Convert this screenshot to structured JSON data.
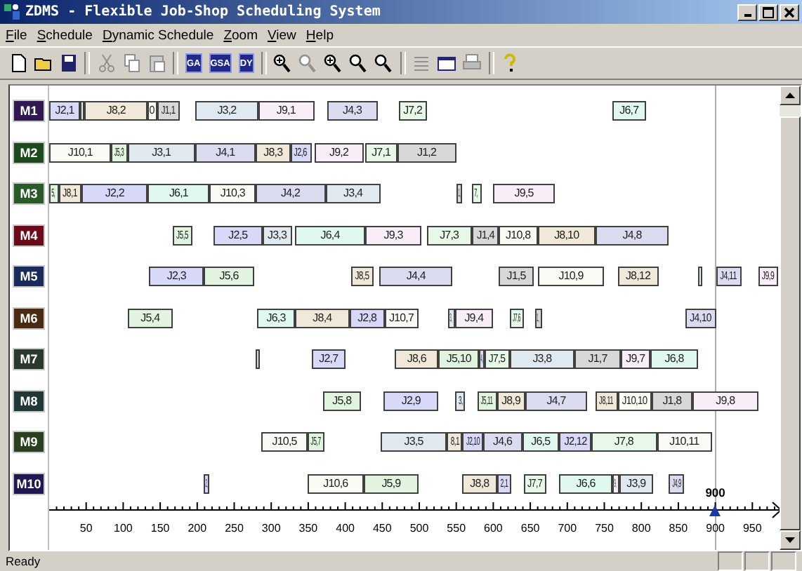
{
  "window": {
    "title": "ZDMS - Flexible Job-Shop Scheduling System"
  },
  "menu": [
    {
      "label": "File"
    },
    {
      "label": "Schedule"
    },
    {
      "label": "Dynamic Schedule"
    },
    {
      "label": "Zoom"
    },
    {
      "label": "View"
    },
    {
      "label": "Help"
    }
  ],
  "toolbar": [
    {
      "kind": "new"
    },
    {
      "kind": "open"
    },
    {
      "kind": "save"
    },
    {
      "kind": "sep"
    },
    {
      "kind": "cut",
      "disabled": true
    },
    {
      "kind": "copy",
      "disabled": true
    },
    {
      "kind": "paste",
      "disabled": true
    },
    {
      "kind": "sep"
    },
    {
      "kind": "text",
      "label": "GA"
    },
    {
      "kind": "text",
      "label": "GSA"
    },
    {
      "kind": "text",
      "label": "DY"
    },
    {
      "kind": "sep"
    },
    {
      "kind": "zoomin"
    },
    {
      "kind": "zoom",
      "disabled": true
    },
    {
      "kind": "zoomin"
    },
    {
      "kind": "zoom"
    },
    {
      "kind": "zoom"
    },
    {
      "kind": "sep"
    },
    {
      "kind": "list",
      "disabled": true
    },
    {
      "kind": "window"
    },
    {
      "kind": "print",
      "disabled": true
    },
    {
      "kind": "sep"
    },
    {
      "kind": "help"
    }
  ],
  "machines": [
    {
      "name": "M1",
      "color": "#301850",
      "ops": [
        {
          "label": "J2,1",
          "color": "#d8d8f8"
        },
        {
          "color": "#e0f4e0"
        },
        {
          "label": "J8,2",
          "color": "#f0e8d8"
        },
        {
          "label": "0",
          "color": "#f8faf4"
        },
        {
          "label": "J1,1",
          "color": "#d8d8d8"
        },
        {
          "label": "J3,2",
          "color": "#e0e8f0"
        },
        {
          "label": "J9,1",
          "color": "#f8eef8"
        },
        {
          "label": "J4,3",
          "color": "#dcdcf0"
        },
        {
          "label": "J7,2",
          "color": "#e8f8e8"
        },
        {
          "label": "J6,7",
          "color": "#e0f8f0"
        }
      ]
    },
    {
      "name": "M2",
      "color": "#1c4a1c",
      "ops": [
        {
          "label": "J10,1",
          "color": "#f8faf4"
        },
        {
          "label": "J5,3",
          "color": "#e0f4e0"
        },
        {
          "label": "J3,1",
          "color": "#e0e8f0"
        },
        {
          "label": "J4,1",
          "color": "#dcdcf0"
        },
        {
          "label": "J8,3",
          "color": "#f0e8d8"
        },
        {
          "label": "J2,6",
          "color": "#d8d8f8"
        },
        {
          "label": "J9,2",
          "color": "#f8eef8"
        },
        {
          "label": "J7,1",
          "color": "#e8f8e8"
        },
        {
          "label": "J1,2",
          "color": "#d8d8d8"
        }
      ]
    },
    {
      "name": "M3",
      "color": "#2a5a2a",
      "ops": [
        {
          "label": "5,",
          "color": "#e0f4e0"
        },
        {
          "label": "J8,1",
          "color": "#f0e8d8"
        },
        {
          "label": "J2,2",
          "color": "#d8d8f8"
        },
        {
          "label": "J6,1",
          "color": "#e0f8f0"
        },
        {
          "label": "J10,3",
          "color": "#f8faf4"
        },
        {
          "label": "J4,2",
          "color": "#dcdcf0"
        },
        {
          "label": "J3,4",
          "color": "#e0e8f0"
        },
        {
          "label": "1,",
          "color": "#d8d8d8"
        },
        {
          "label": "7,",
          "color": "#e8f8e8"
        },
        {
          "label": "J9,5",
          "color": "#f8eef8"
        }
      ]
    },
    {
      "name": "M4",
      "color": "#6a0a1a",
      "ops": [
        {
          "label": "J5,5",
          "color": "#e0f4e0"
        },
        {
          "label": "J2,5",
          "color": "#d8d8f8"
        },
        {
          "label": "J3,3",
          "color": "#e0e8f0"
        },
        {
          "label": "J6,4",
          "color": "#e0f8f0"
        },
        {
          "label": "J9,3",
          "color": "#f8eef8"
        },
        {
          "label": "J7,3",
          "color": "#e8f8e8"
        },
        {
          "label": "J1,4",
          "color": "#d8d8d8"
        },
        {
          "label": "J10,8",
          "color": "#f8faf4"
        },
        {
          "label": "J8,10",
          "color": "#f0e8d8"
        },
        {
          "label": "J4,8",
          "color": "#dcdcf0"
        }
      ]
    },
    {
      "name": "M5",
      "color": "#1a2a5a",
      "ops": [
        {
          "label": "J2,3",
          "color": "#d8d8f8"
        },
        {
          "label": "J5,6",
          "color": "#e0f4e0"
        },
        {
          "label": "J8,5",
          "color": "#f0e8d8"
        },
        {
          "label": "J4,4",
          "color": "#dcdcf0"
        },
        {
          "label": "J1,5",
          "color": "#d8d8d8"
        },
        {
          "label": "J10,9",
          "color": "#f8faf4"
        },
        {
          "label": "J8,12",
          "color": "#f0e8d8"
        },
        {
          "color": "#e0f4e0"
        },
        {
          "label": "J4,11",
          "color": "#dcdcf0"
        },
        {
          "label": "J9,9",
          "color": "#f8eef8"
        }
      ]
    },
    {
      "name": "M6",
      "color": "#4a2a10",
      "ops": [
        {
          "label": "J5,4",
          "color": "#e0f4e0"
        },
        {
          "label": "J6,3",
          "color": "#e0f8f0"
        },
        {
          "label": "J8,4",
          "color": "#f0e8d8"
        },
        {
          "label": "J2,8",
          "color": "#d8d8f8"
        },
        {
          "label": "J10,7",
          "color": "#f8faf4"
        },
        {
          "label": "3,",
          "color": "#e0e8f0"
        },
        {
          "label": "J9,4",
          "color": "#f8eef8"
        },
        {
          "label": "J7,6",
          "color": "#e8f8e8"
        },
        {
          "label": "1,",
          "color": "#d8d8d8"
        },
        {
          "label": "J4,10",
          "color": "#dcdcf0"
        }
      ]
    },
    {
      "name": "M7",
      "color": "#2a3a2a",
      "ops": [
        {
          "color": "#d8d8d8"
        },
        {
          "label": "J2,7",
          "color": "#d8d8f8"
        },
        {
          "label": "J8,6",
          "color": "#f0e8d8"
        },
        {
          "label": "J5,10",
          "color": "#e0f4e0"
        },
        {
          "label": "4,",
          "color": "#dcdcf0"
        },
        {
          "label": "J7,5",
          "color": "#e8f8e8"
        },
        {
          "label": "J3,8",
          "color": "#e0e8f0"
        },
        {
          "label": "J1,7",
          "color": "#d8d8d8"
        },
        {
          "label": "J9,7",
          "color": "#f8eef8"
        },
        {
          "label": "J6,8",
          "color": "#e0f8f0"
        }
      ]
    },
    {
      "name": "M8",
      "color": "#203838",
      "ops": [
        {
          "label": "J5,8",
          "color": "#e0f4e0"
        },
        {
          "label": "J2,9",
          "color": "#d8d8f8"
        },
        {
          "label": "3,",
          "color": "#e0e8f0"
        },
        {
          "label": "J5,11",
          "color": "#e0f4e0"
        },
        {
          "label": "J8,9",
          "color": "#f0e8d8"
        },
        {
          "label": "J4,7",
          "color": "#dcdcf0"
        },
        {
          "label": "J8,11",
          "color": "#f0e8d8"
        },
        {
          "label": "J10,10",
          "color": "#f8faf4"
        },
        {
          "label": "J1,8",
          "color": "#d8d8d8"
        },
        {
          "label": "J9,8",
          "color": "#f8eef8"
        }
      ]
    },
    {
      "name": "M9",
      "color": "#2a4020",
      "ops": [
        {
          "label": "J10,5",
          "color": "#f8faf4"
        },
        {
          "label": "J5,7",
          "color": "#e0f4e0"
        },
        {
          "label": "J3,5",
          "color": "#e0e8f0"
        },
        {
          "label": "8,1",
          "color": "#f0e8d8"
        },
        {
          "label": "J2,10",
          "color": "#d8d8f8"
        },
        {
          "label": "J4,6",
          "color": "#dcdcf0"
        },
        {
          "label": "J6,5",
          "color": "#e0f8f0"
        },
        {
          "label": "J2,12",
          "color": "#d8d8f8"
        },
        {
          "label": "J7,8",
          "color": "#e8f8e8"
        },
        {
          "label": "J10,11",
          "color": "#f8faf4"
        }
      ]
    },
    {
      "name": "M10",
      "color": "#201850",
      "ops": [
        {
          "label": "2,",
          "color": "#d8d8f8"
        },
        {
          "label": "J10,6",
          "color": "#f8faf4"
        },
        {
          "label": "J5,9",
          "color": "#e0f4e0"
        },
        {
          "label": "J8,8",
          "color": "#f0e8d8"
        },
        {
          "label": "2,1",
          "color": "#d8d8f8"
        },
        {
          "label": "J7,7",
          "color": "#e8f8e8"
        },
        {
          "label": "J6,6",
          "color": "#e0f8f0"
        },
        {
          "label": "9,",
          "color": "#f8eef8"
        },
        {
          "label": "J3,9",
          "color": "#e0e8f0"
        },
        {
          "label": "J4,9",
          "color": "#dcdcf0"
        }
      ]
    }
  ],
  "axis": {
    "ticks": [
      "50",
      "100",
      "150",
      "200",
      "250",
      "300",
      "350",
      "400",
      "450",
      "500",
      "550",
      "600",
      "650",
      "700",
      "750",
      "800",
      "850",
      "900",
      "950"
    ],
    "marker": {
      "label": "900"
    }
  },
  "status_bar": {
    "text": "Ready"
  }
}
